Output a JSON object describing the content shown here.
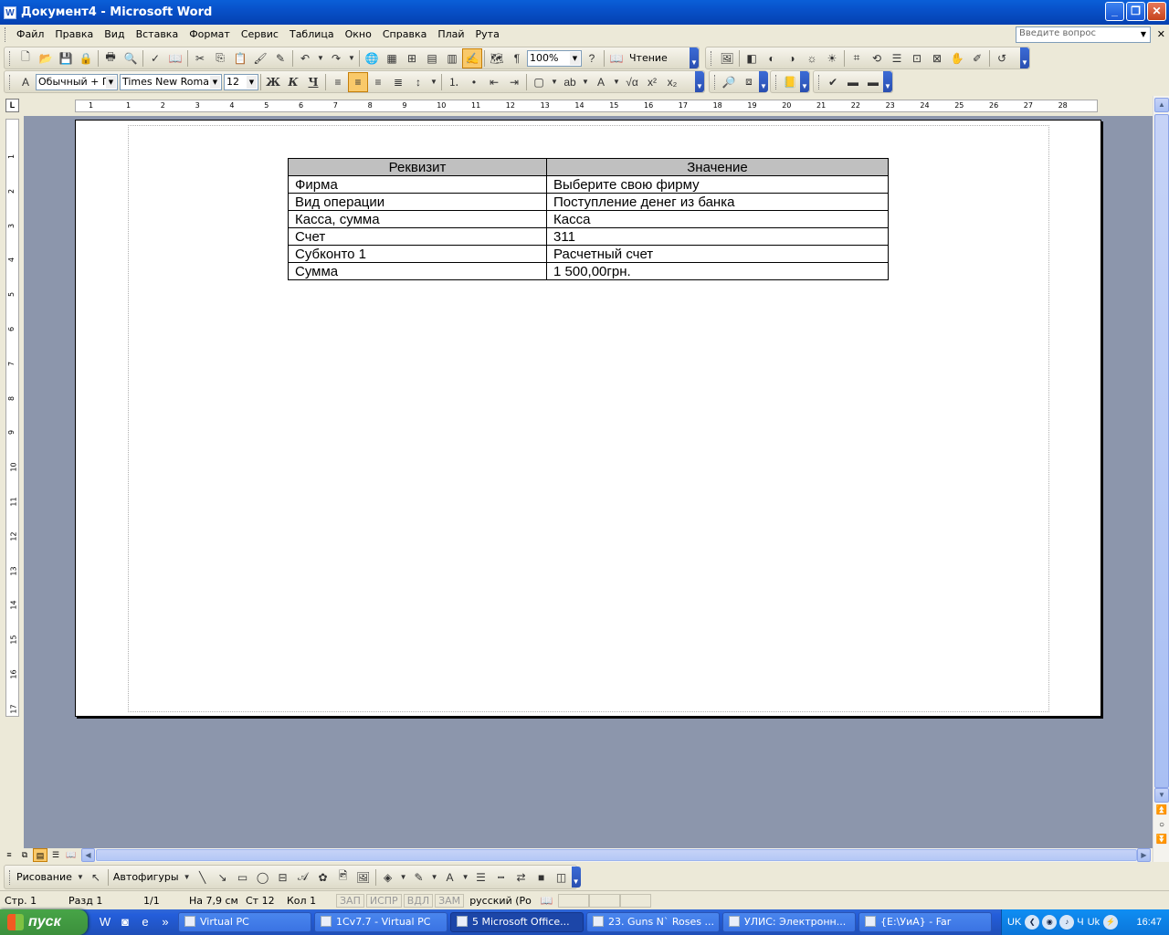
{
  "window": {
    "title": "Документ4 - Microsoft Word"
  },
  "menu": {
    "items": [
      "Файл",
      "Правка",
      "Вид",
      "Вставка",
      "Формат",
      "Сервис",
      "Таблица",
      "Окно",
      "Справка",
      "Плай",
      "Рута"
    ]
  },
  "ask": {
    "placeholder": "Введите вопрос"
  },
  "toolbar": {
    "zoom": "100%",
    "reading_label": "Чтение"
  },
  "formatting": {
    "style": "Обычный + По",
    "font": "Times New Roman",
    "size": "12"
  },
  "ruler": {
    "h_numbers": [
      "1",
      "1",
      "2",
      "3",
      "4",
      "5",
      "6",
      "7",
      "8",
      "9",
      "10",
      "11",
      "12",
      "13",
      "14",
      "15",
      "16",
      "17",
      "18",
      "19",
      "20",
      "21",
      "22",
      "23",
      "24",
      "25",
      "26",
      "27",
      "28"
    ],
    "v_numbers": [
      "1",
      "2",
      "3",
      "4",
      "5",
      "6",
      "7",
      "8",
      "9",
      "10",
      "11",
      "12",
      "13",
      "14",
      "15",
      "16",
      "17"
    ]
  },
  "table": {
    "headers": [
      "Реквизит",
      "Значение"
    ],
    "rows": [
      [
        "Фирма",
        "Выберите свою фирму"
      ],
      [
        "Вид операции",
        "Поступление денег из банка"
      ],
      [
        "Касса, сумма",
        "Касса"
      ],
      [
        "Счет",
        "311"
      ],
      [
        "Субконто 1",
        "Расчетный счет"
      ],
      [
        "Сумма",
        "1 500,00грн."
      ]
    ]
  },
  "drawing": {
    "draw_label": "Рисование",
    "autoshapes_label": "Автофигуры"
  },
  "status": {
    "page": "Стр. 1",
    "section": "Разд 1",
    "pages": "1/1",
    "at": "На 7,9 см",
    "line": "Ст 12",
    "col": "Кол 1",
    "rec": "ЗАП",
    "trk": "ИСПР",
    "ext": "ВДЛ",
    "ovr": "ЗАМ",
    "lang": "русский (Ро"
  },
  "taskbar": {
    "start_label": "пуск",
    "tasks": [
      "Virtual PC",
      "1Cv7.7 - Virtual PC",
      "5 Microsoft Office...",
      "23. Guns N` Roses ...",
      "УЛИС: Электронн...",
      "{E:\\УиА} - Far"
    ],
    "tray_lang": "UK",
    "tray_uk": "Uk",
    "tray_ch": "Ч",
    "clock": "16:47"
  }
}
